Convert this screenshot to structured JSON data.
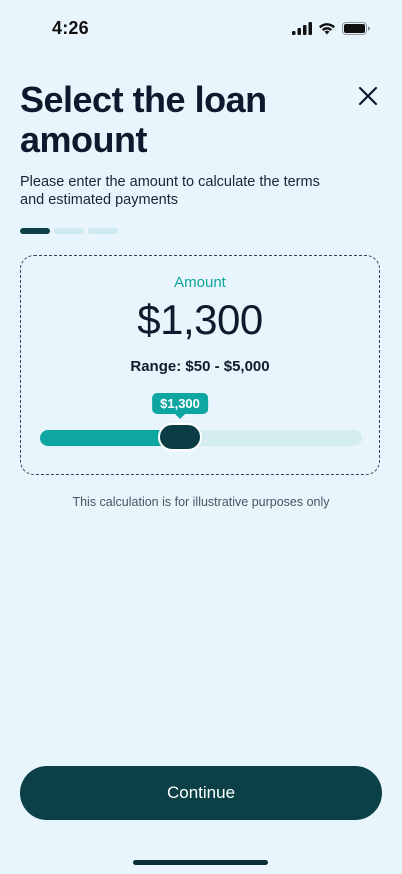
{
  "status_bar": {
    "time": "4:26",
    "icons": [
      "cellular-signal-icon",
      "wifi-icon",
      "battery-icon"
    ]
  },
  "header": {
    "title": "Select the loan amount",
    "subtitle": "Please enter the amount to calculate the terms and estimated payments",
    "close_icon": "close-icon"
  },
  "steps": {
    "total": 3,
    "current": 1
  },
  "calculator": {
    "label": "Amount",
    "value": "$1,300",
    "range": "Range: $50 - $5,000",
    "slider": {
      "min": 50,
      "max": 5000,
      "value": 1300,
      "tooltip": "$1,300"
    }
  },
  "disclaimer": "This calculation is for illustrative purposes only",
  "continue_label": "Continue",
  "colors": {
    "background": "#E8F5FC",
    "accent": "#0EA6A0",
    "primary_dark": "#0A4046",
    "track": "#D3EDF0"
  }
}
